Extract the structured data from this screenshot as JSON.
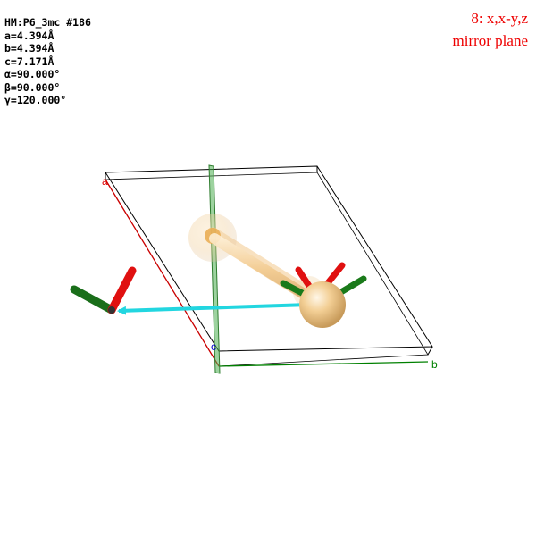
{
  "cell_info": {
    "space_group": "HM:P6_3mc #186",
    "a": "a=4.394Å",
    "b": "b=4.394Å",
    "c": "c=7.171Å",
    "alpha": "α=90.000°",
    "beta": "β=90.000°",
    "gamma": "γ=120.000°"
  },
  "symmetry_op": {
    "label": "8: x,x-y,z",
    "description": "mirror plane",
    "color": "#ee0000"
  },
  "axis_labels": {
    "a": "a",
    "b": "b",
    "c": "c"
  },
  "colors": {
    "axis_a": "#ff0000",
    "axis_b": "#008000",
    "axis_c": "#0000ff",
    "atom": "#f3cf95",
    "translation_arrow": "#22d6e0",
    "cell_edge": "#000000"
  },
  "icons": [
    "mirror-plane",
    "atom",
    "bond",
    "translation-arrow",
    "axis-triad",
    "unit-cell"
  ]
}
